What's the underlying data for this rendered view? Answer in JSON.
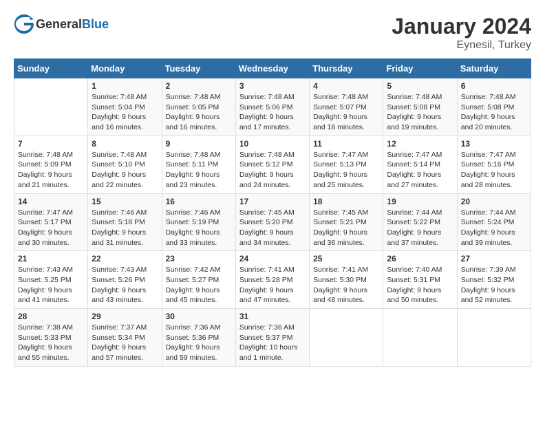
{
  "header": {
    "logo_general": "General",
    "logo_blue": "Blue",
    "month": "January 2024",
    "location": "Eynesil, Turkey"
  },
  "days_of_week": [
    "Sunday",
    "Monday",
    "Tuesday",
    "Wednesday",
    "Thursday",
    "Friday",
    "Saturday"
  ],
  "weeks": [
    [
      {
        "day": "",
        "sunrise": "",
        "sunset": "",
        "daylight": ""
      },
      {
        "day": "1",
        "sunrise": "Sunrise: 7:48 AM",
        "sunset": "Sunset: 5:04 PM",
        "daylight": "Daylight: 9 hours and 16 minutes."
      },
      {
        "day": "2",
        "sunrise": "Sunrise: 7:48 AM",
        "sunset": "Sunset: 5:05 PM",
        "daylight": "Daylight: 9 hours and 16 minutes."
      },
      {
        "day": "3",
        "sunrise": "Sunrise: 7:48 AM",
        "sunset": "Sunset: 5:06 PM",
        "daylight": "Daylight: 9 hours and 17 minutes."
      },
      {
        "day": "4",
        "sunrise": "Sunrise: 7:48 AM",
        "sunset": "Sunset: 5:07 PM",
        "daylight": "Daylight: 9 hours and 18 minutes."
      },
      {
        "day": "5",
        "sunrise": "Sunrise: 7:48 AM",
        "sunset": "Sunset: 5:08 PM",
        "daylight": "Daylight: 9 hours and 19 minutes."
      },
      {
        "day": "6",
        "sunrise": "Sunrise: 7:48 AM",
        "sunset": "Sunset: 5:08 PM",
        "daylight": "Daylight: 9 hours and 20 minutes."
      }
    ],
    [
      {
        "day": "7",
        "sunrise": "",
        "sunset": "",
        "daylight": ""
      },
      {
        "day": "8",
        "sunrise": "Sunrise: 7:48 AM",
        "sunset": "Sunset: 5:10 PM",
        "daylight": "Daylight: 9 hours and 22 minutes."
      },
      {
        "day": "9",
        "sunrise": "Sunrise: 7:48 AM",
        "sunset": "Sunset: 5:11 PM",
        "daylight": "Daylight: 9 hours and 23 minutes."
      },
      {
        "day": "10",
        "sunrise": "Sunrise: 7:48 AM",
        "sunset": "Sunset: 5:12 PM",
        "daylight": "Daylight: 9 hours and 24 minutes."
      },
      {
        "day": "11",
        "sunrise": "Sunrise: 7:47 AM",
        "sunset": "Sunset: 5:13 PM",
        "daylight": "Daylight: 9 hours and 25 minutes."
      },
      {
        "day": "12",
        "sunrise": "Sunrise: 7:47 AM",
        "sunset": "Sunset: 5:14 PM",
        "daylight": "Daylight: 9 hours and 27 minutes."
      },
      {
        "day": "13",
        "sunrise": "Sunrise: 7:47 AM",
        "sunset": "Sunset: 5:16 PM",
        "daylight": "Daylight: 9 hours and 28 minutes."
      }
    ],
    [
      {
        "day": "14",
        "sunrise": "",
        "sunset": "",
        "daylight": ""
      },
      {
        "day": "15",
        "sunrise": "Sunrise: 7:46 AM",
        "sunset": "Sunset: 5:18 PM",
        "daylight": "Daylight: 9 hours and 31 minutes."
      },
      {
        "day": "16",
        "sunrise": "Sunrise: 7:46 AM",
        "sunset": "Sunset: 5:19 PM",
        "daylight": "Daylight: 9 hours and 33 minutes."
      },
      {
        "day": "17",
        "sunrise": "Sunrise: 7:45 AM",
        "sunset": "Sunset: 5:20 PM",
        "daylight": "Daylight: 9 hours and 34 minutes."
      },
      {
        "day": "18",
        "sunrise": "Sunrise: 7:45 AM",
        "sunset": "Sunset: 5:21 PM",
        "daylight": "Daylight: 9 hours and 36 minutes."
      },
      {
        "day": "19",
        "sunrise": "Sunrise: 7:44 AM",
        "sunset": "Sunset: 5:22 PM",
        "daylight": "Daylight: 9 hours and 37 minutes."
      },
      {
        "day": "20",
        "sunrise": "Sunrise: 7:44 AM",
        "sunset": "Sunset: 5:24 PM",
        "daylight": "Daylight: 9 hours and 39 minutes."
      }
    ],
    [
      {
        "day": "21",
        "sunrise": "",
        "sunset": "",
        "daylight": ""
      },
      {
        "day": "22",
        "sunrise": "Sunrise: 7:43 AM",
        "sunset": "Sunset: 5:26 PM",
        "daylight": "Daylight: 9 hours and 43 minutes."
      },
      {
        "day": "23",
        "sunrise": "Sunrise: 7:42 AM",
        "sunset": "Sunset: 5:27 PM",
        "daylight": "Daylight: 9 hours and 45 minutes."
      },
      {
        "day": "24",
        "sunrise": "Sunrise: 7:41 AM",
        "sunset": "Sunset: 5:28 PM",
        "daylight": "Daylight: 9 hours and 47 minutes."
      },
      {
        "day": "25",
        "sunrise": "Sunrise: 7:41 AM",
        "sunset": "Sunset: 5:30 PM",
        "daylight": "Daylight: 9 hours and 48 minutes."
      },
      {
        "day": "26",
        "sunrise": "Sunrise: 7:40 AM",
        "sunset": "Sunset: 5:31 PM",
        "daylight": "Daylight: 9 hours and 50 minutes."
      },
      {
        "day": "27",
        "sunrise": "Sunrise: 7:39 AM",
        "sunset": "Sunset: 5:32 PM",
        "daylight": "Daylight: 9 hours and 52 minutes."
      }
    ],
    [
      {
        "day": "28",
        "sunrise": "Sunrise: 7:38 AM",
        "sunset": "Sunset: 5:33 PM",
        "daylight": "Daylight: 9 hours and 55 minutes."
      },
      {
        "day": "29",
        "sunrise": "Sunrise: 7:37 AM",
        "sunset": "Sunset: 5:34 PM",
        "daylight": "Daylight: 9 hours and 57 minutes."
      },
      {
        "day": "30",
        "sunrise": "Sunrise: 7:36 AM",
        "sunset": "Sunset: 5:36 PM",
        "daylight": "Daylight: 9 hours and 59 minutes."
      },
      {
        "day": "31",
        "sunrise": "Sunrise: 7:36 AM",
        "sunset": "Sunset: 5:37 PM",
        "daylight": "Daylight: 10 hours and 1 minute."
      },
      {
        "day": "",
        "sunrise": "",
        "sunset": "",
        "daylight": ""
      },
      {
        "day": "",
        "sunrise": "",
        "sunset": "",
        "daylight": ""
      },
      {
        "day": "",
        "sunrise": "",
        "sunset": "",
        "daylight": ""
      }
    ]
  ],
  "week1_sunday": {
    "sunrise": "Sunrise: 7:48 AM",
    "sunset": "Sunset: 5:09 PM",
    "daylight": "Daylight: 9 hours and 21 minutes."
  },
  "week3_sunday": {
    "sunrise": "Sunrise: 7:47 AM",
    "sunset": "Sunset: 5:17 PM",
    "daylight": "Daylight: 9 hours and 30 minutes."
  },
  "week4_sunday": {
    "sunrise": "Sunrise: 7:43 AM",
    "sunset": "Sunset: 5:25 PM",
    "daylight": "Daylight: 9 hours and 41 minutes."
  }
}
